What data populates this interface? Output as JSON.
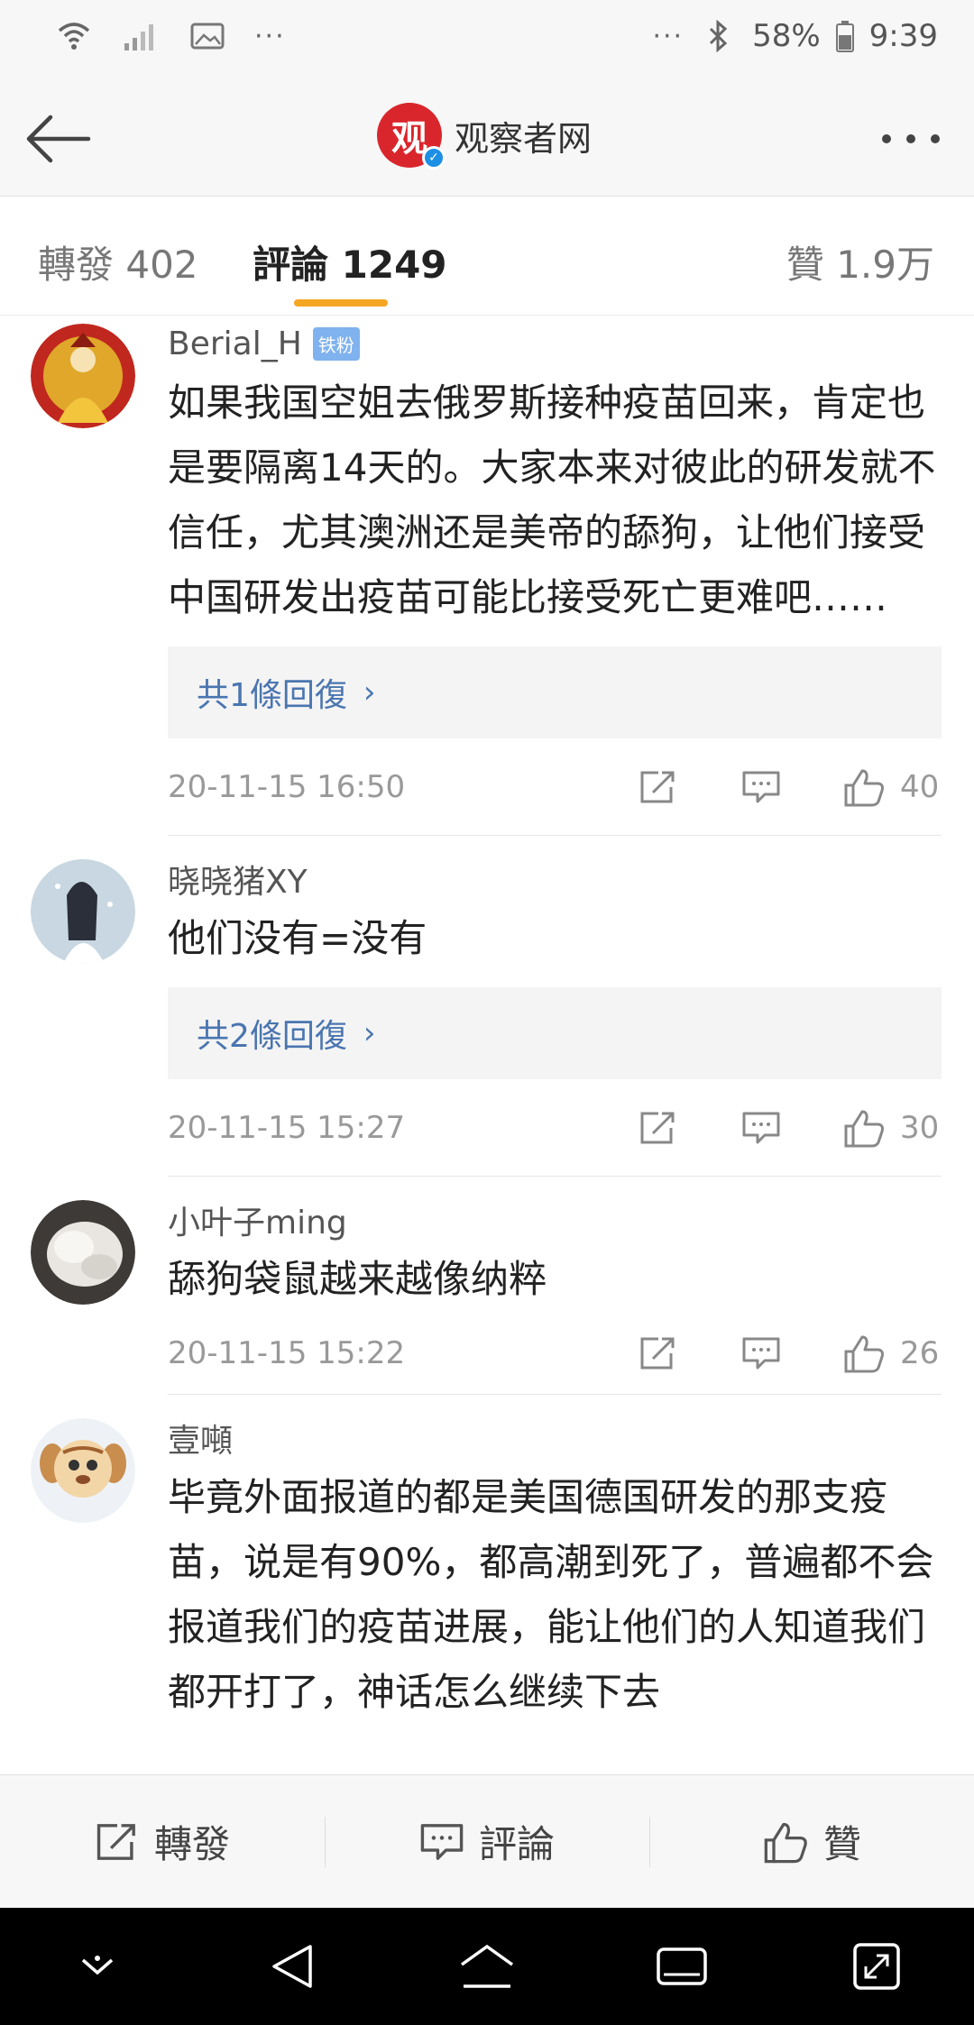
{
  "status_bar": {
    "left_dots": "···",
    "right_dots": "···",
    "battery": "58%",
    "time": "9:39"
  },
  "header": {
    "logo_char": "观",
    "title": "观察者网"
  },
  "tabs": {
    "repost": "轉發 402",
    "comments": "評論 1249",
    "likes": "贊 1.9万"
  },
  "comments": [
    {
      "user": "Berial_H",
      "badge": "铁粉",
      "text": "如果我国空姐去俄罗斯接种疫苗回来，肯定也是要隔离14天的。大家本来对彼此的研发就不信任，尤其澳洲还是美帝的舔狗，让他们接受中国研发出疫苗可能比接受死亡更难吧……",
      "replies": "共1條回復",
      "date": "20-11-15 16:50",
      "likes": "40"
    },
    {
      "user": "晓晓猪XY",
      "text": "他们没有=没有",
      "replies": "共2條回復",
      "date": "20-11-15 15:27",
      "likes": "30"
    },
    {
      "user": "小叶子ming",
      "text": "舔狗袋鼠越来越像纳粹",
      "date": "20-11-15 15:22",
      "likes": "26"
    },
    {
      "user": "壹噸",
      "text": "毕竟外面报道的都是美国德国研发的那支疫苗，说是有90%，都高潮到死了，普遍都不会报道我们的疫苗进展，能让他们的人知道我们都开打了，神话怎么继续下去"
    }
  ],
  "bottom_bar": {
    "repost": "轉發",
    "comment": "評論",
    "like": "贊"
  },
  "colors": {
    "accent": "#f5a623",
    "link": "#4a75b0",
    "brand_red": "#d9262c"
  }
}
